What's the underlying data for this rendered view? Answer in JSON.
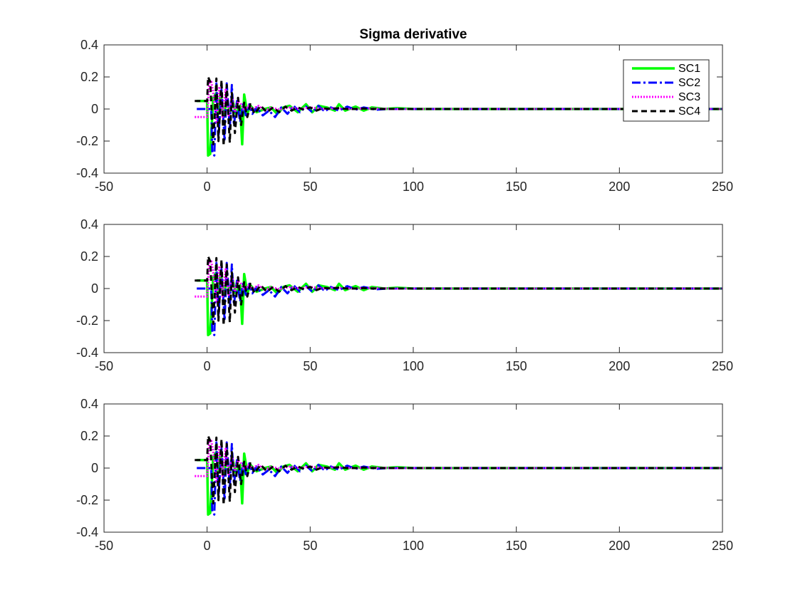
{
  "chart_data": [
    {
      "type": "line",
      "title": "Sigma derivative",
      "xlim": [
        -50,
        250
      ],
      "ylim": [
        -0.4,
        0.4
      ],
      "xticks": [
        -50,
        0,
        50,
        100,
        150,
        200,
        250
      ],
      "xtick_labels": [
        "-50",
        "0",
        "50",
        "100",
        "150",
        "200",
        "250"
      ],
      "yticks": [
        -0.4,
        -0.2,
        0,
        0.2,
        0.4
      ],
      "ytick_labels": [
        "-0.4",
        "-0.2",
        "0",
        "0.2",
        "0.4"
      ],
      "grid": false,
      "legend": {
        "placement": "top-right",
        "entries": [
          "SC1",
          "SC2",
          "SC3",
          "SC4"
        ]
      },
      "series": [
        {
          "name": "SC1",
          "color": "#00ff00",
          "style": "solid",
          "x": [
            -5,
            0,
            0.5,
            1.5,
            3,
            4.5,
            5.5,
            6.5,
            8,
            9.5,
            11,
            12.5,
            14,
            16,
            17,
            18,
            19.5,
            21,
            24,
            28,
            31,
            34,
            37,
            40,
            44,
            48,
            51,
            54,
            58,
            62,
            64,
            67,
            72,
            76,
            80,
            86,
            92,
            100,
            110,
            250
          ],
          "y": [
            0.05,
            0.05,
            -0.29,
            -0.28,
            0.07,
            0.1,
            -0.03,
            0.1,
            -0.05,
            0.06,
            -0.02,
            0.05,
            -0.03,
            0.02,
            -0.22,
            0.09,
            -0.03,
            0.02,
            -0.02,
            0.0,
            0.01,
            -0.03,
            0.01,
            0.02,
            -0.02,
            0.03,
            -0.02,
            0.02,
            0.01,
            -0.01,
            0.03,
            -0.01,
            0.015,
            -0.01,
            0.01,
            0.0,
            0.005,
            0.0,
            0.0,
            0.0
          ]
        },
        {
          "name": "SC2",
          "color": "#0000ff",
          "style": "dashdot",
          "x": [
            -5,
            2,
            2.5,
            3.5,
            4.5,
            5.5,
            7,
            8.5,
            9.5,
            11,
            12,
            13,
            14.5,
            16,
            17.5,
            19,
            20.5,
            22,
            24,
            27,
            30,
            33,
            36,
            39,
            42,
            45,
            48,
            51,
            54,
            57,
            60,
            64,
            68,
            72,
            76,
            82,
            88,
            96,
            106,
            250
          ],
          "y": [
            0.0,
            0.0,
            -0.27,
            -0.29,
            0.16,
            -0.18,
            0.12,
            -0.2,
            0.16,
            -0.12,
            0.15,
            -0.1,
            0.05,
            -0.08,
            0.03,
            -0.05,
            0.03,
            -0.03,
            0.01,
            -0.04,
            -0.01,
            -0.05,
            0.01,
            -0.03,
            0.02,
            -0.02,
            0.015,
            -0.02,
            0.02,
            -0.015,
            0.01,
            -0.01,
            0.015,
            -0.005,
            0.01,
            -0.005,
            0.0,
            0.0,
            0.0,
            0.0
          ]
        },
        {
          "name": "SC3",
          "color": "#ff00ff",
          "style": "dotted",
          "x": [
            -6,
            0,
            1,
            2,
            3,
            4.5,
            6,
            7.5,
            9,
            10.5,
            12,
            13.5,
            15,
            16.5,
            18,
            20,
            22,
            25,
            28,
            31,
            35,
            40,
            45,
            50,
            56,
            62,
            70,
            80,
            90,
            100,
            250
          ],
          "y": [
            -0.05,
            -0.05,
            0.16,
            0.17,
            0.1,
            -0.08,
            0.14,
            -0.05,
            0.12,
            -0.04,
            0.08,
            -0.02,
            0.05,
            0.03,
            -0.01,
            0.02,
            0.0,
            0.02,
            -0.01,
            0.01,
            -0.005,
            0.01,
            0.0,
            0.01,
            0.0,
            0.005,
            0.0,
            0.003,
            0.0,
            0.0,
            0.0
          ]
        },
        {
          "name": "SC4",
          "color": "#000000",
          "style": "dashed",
          "x": [
            -6,
            0,
            0.5,
            1.5,
            3,
            4.5,
            5.5,
            7,
            8,
            9.5,
            11,
            12,
            13.5,
            15,
            16.5,
            18,
            19.5,
            21,
            23,
            26,
            29,
            32,
            35,
            38,
            41,
            44,
            47,
            50,
            53,
            56,
            60,
            64,
            68,
            72,
            76,
            80,
            86,
            94,
            250
          ],
          "y": [
            0.05,
            0.05,
            0.2,
            0.17,
            -0.22,
            0.19,
            -0.2,
            0.18,
            -0.23,
            0.15,
            -0.21,
            0.1,
            -0.15,
            0.07,
            -0.1,
            0.04,
            -0.05,
            0.03,
            -0.03,
            0.02,
            -0.02,
            0.01,
            -0.02,
            0.015,
            -0.01,
            0.01,
            -0.005,
            0.01,
            -0.01,
            0.005,
            0.0,
            0.005,
            0.0,
            0.0,
            0.003,
            0.0,
            0.0,
            0.0,
            0.0
          ]
        }
      ]
    },
    {
      "type": "line",
      "title": "",
      "xlim": [
        -50,
        250
      ],
      "ylim": [
        -0.4,
        0.4
      ],
      "xticks": [
        -50,
        0,
        50,
        100,
        150,
        200,
        250
      ],
      "xtick_labels": [
        "-50",
        "0",
        "50",
        "100",
        "150",
        "200",
        "250"
      ],
      "yticks": [
        -0.4,
        -0.2,
        0,
        0.2,
        0.4
      ],
      "ytick_labels": [
        "-0.4",
        "-0.2",
        "0",
        "0.2",
        "0.4"
      ],
      "grid": false,
      "series": [
        {
          "color": "#00ff00",
          "style": "solid",
          "x": [
            -5,
            0,
            0.5,
            1.5,
            3,
            4.5,
            5.5,
            6.5,
            8,
            9.5,
            11,
            12.5,
            14,
            16,
            17,
            18,
            19.5,
            21,
            24,
            28,
            31,
            34,
            37,
            40,
            44,
            48,
            51,
            54,
            58,
            62,
            64,
            67,
            72,
            76,
            80,
            86,
            92,
            100,
            110,
            250
          ],
          "y": [
            0.05,
            0.05,
            -0.29,
            -0.28,
            0.07,
            0.1,
            -0.03,
            0.1,
            -0.05,
            0.06,
            -0.02,
            0.05,
            -0.03,
            0.02,
            -0.22,
            0.09,
            -0.03,
            0.02,
            -0.02,
            0.0,
            0.01,
            -0.03,
            0.01,
            0.02,
            -0.02,
            0.03,
            -0.02,
            0.02,
            0.01,
            -0.01,
            0.03,
            -0.01,
            0.015,
            -0.01,
            0.01,
            0.0,
            0.005,
            0.0,
            0.0,
            0.0
          ]
        },
        {
          "color": "#0000ff",
          "style": "dashdot",
          "x": [
            -5,
            2,
            2.5,
            3.5,
            4.5,
            5.5,
            7,
            8.5,
            9.5,
            11,
            12,
            13,
            14.5,
            16,
            17.5,
            19,
            20.5,
            22,
            24,
            27,
            30,
            33,
            36,
            39,
            42,
            45,
            48,
            51,
            54,
            57,
            60,
            64,
            68,
            72,
            76,
            82,
            88,
            96,
            106,
            250
          ],
          "y": [
            0.0,
            0.0,
            -0.27,
            -0.29,
            0.16,
            -0.18,
            0.12,
            -0.2,
            0.16,
            -0.12,
            0.15,
            -0.1,
            0.05,
            -0.08,
            0.03,
            -0.05,
            0.03,
            -0.03,
            0.01,
            -0.04,
            -0.01,
            -0.05,
            0.01,
            -0.03,
            0.02,
            -0.02,
            0.015,
            -0.02,
            0.02,
            -0.015,
            0.01,
            -0.01,
            0.015,
            -0.005,
            0.01,
            -0.005,
            0.0,
            0.0,
            0.0,
            0.0
          ]
        },
        {
          "color": "#ff00ff",
          "style": "dotted",
          "x": [
            -6,
            0,
            1,
            2,
            3,
            4.5,
            6,
            7.5,
            9,
            10.5,
            12,
            13.5,
            15,
            16.5,
            18,
            20,
            22,
            25,
            28,
            31,
            35,
            40,
            45,
            50,
            56,
            62,
            70,
            80,
            90,
            100,
            250
          ],
          "y": [
            -0.05,
            -0.05,
            0.16,
            0.17,
            0.1,
            -0.08,
            0.14,
            -0.05,
            0.12,
            -0.04,
            0.08,
            -0.02,
            0.05,
            0.03,
            -0.01,
            0.02,
            0.0,
            0.02,
            -0.01,
            0.01,
            -0.005,
            0.01,
            0.0,
            0.01,
            0.0,
            0.005,
            0.0,
            0.003,
            0.0,
            0.0,
            0.0
          ]
        },
        {
          "color": "#000000",
          "style": "dashed",
          "x": [
            -6,
            0,
            0.5,
            1.5,
            3,
            4.5,
            5.5,
            7,
            8,
            9.5,
            11,
            12,
            13.5,
            15,
            16.5,
            18,
            19.5,
            21,
            23,
            26,
            29,
            32,
            35,
            38,
            41,
            44,
            47,
            50,
            53,
            56,
            60,
            64,
            68,
            72,
            76,
            80,
            86,
            94,
            250
          ],
          "y": [
            0.05,
            0.05,
            0.2,
            0.17,
            -0.22,
            0.19,
            -0.2,
            0.18,
            -0.23,
            0.15,
            -0.21,
            0.1,
            -0.15,
            0.07,
            -0.1,
            0.04,
            -0.05,
            0.03,
            -0.03,
            0.02,
            -0.02,
            0.01,
            -0.02,
            0.015,
            -0.01,
            0.01,
            -0.005,
            0.01,
            -0.01,
            0.005,
            0.0,
            0.005,
            0.0,
            0.0,
            0.003,
            0.0,
            0.0,
            0.0,
            0.0
          ]
        }
      ]
    },
    {
      "type": "line",
      "title": "",
      "xlim": [
        -50,
        250
      ],
      "ylim": [
        -0.4,
        0.4
      ],
      "xticks": [
        -50,
        0,
        50,
        100,
        150,
        200,
        250
      ],
      "xtick_labels": [
        "-50",
        "0",
        "50",
        "100",
        "150",
        "200",
        "250"
      ],
      "yticks": [
        -0.4,
        -0.2,
        0,
        0.2,
        0.4
      ],
      "ytick_labels": [
        "-0.4",
        "-0.2",
        "0",
        "0.2",
        "0.4"
      ],
      "grid": false,
      "series": [
        {
          "color": "#00ff00",
          "style": "solid",
          "x": [
            -5,
            0,
            0.5,
            1.5,
            3,
            4.5,
            5.5,
            6.5,
            8,
            9.5,
            11,
            12.5,
            14,
            16,
            17,
            18,
            19.5,
            21,
            24,
            28,
            31,
            34,
            37,
            40,
            44,
            48,
            51,
            54,
            58,
            62,
            64,
            67,
            72,
            76,
            80,
            86,
            92,
            100,
            110,
            250
          ],
          "y": [
            0.05,
            0.05,
            -0.29,
            -0.28,
            0.07,
            0.1,
            -0.03,
            0.1,
            -0.05,
            0.06,
            -0.02,
            0.05,
            -0.03,
            0.02,
            -0.22,
            0.09,
            -0.03,
            0.02,
            -0.02,
            0.0,
            0.01,
            -0.03,
            0.01,
            0.02,
            -0.02,
            0.03,
            -0.02,
            0.02,
            0.01,
            -0.01,
            0.03,
            -0.01,
            0.015,
            -0.01,
            0.01,
            0.0,
            0.005,
            0.0,
            0.0,
            0.0
          ]
        },
        {
          "color": "#0000ff",
          "style": "dashdot",
          "x": [
            -5,
            2,
            2.5,
            3.5,
            4.5,
            5.5,
            7,
            8.5,
            9.5,
            11,
            12,
            13,
            14.5,
            16,
            17.5,
            19,
            20.5,
            22,
            24,
            27,
            30,
            33,
            36,
            39,
            42,
            45,
            48,
            51,
            54,
            57,
            60,
            64,
            68,
            72,
            76,
            82,
            88,
            96,
            106,
            250
          ],
          "y": [
            0.0,
            0.0,
            -0.27,
            -0.29,
            0.16,
            -0.18,
            0.12,
            -0.2,
            0.16,
            -0.12,
            0.15,
            -0.1,
            0.05,
            -0.08,
            0.03,
            -0.05,
            0.03,
            -0.03,
            0.01,
            -0.04,
            -0.01,
            -0.05,
            0.01,
            -0.03,
            0.02,
            -0.02,
            0.015,
            -0.02,
            0.02,
            -0.015,
            0.01,
            -0.01,
            0.015,
            -0.005,
            0.01,
            -0.005,
            0.0,
            0.0,
            0.0,
            0.0
          ]
        },
        {
          "color": "#ff00ff",
          "style": "dotted",
          "x": [
            -6,
            0,
            1,
            2,
            3,
            4.5,
            6,
            7.5,
            9,
            10.5,
            12,
            13.5,
            15,
            16.5,
            18,
            20,
            22,
            25,
            28,
            31,
            35,
            40,
            45,
            50,
            56,
            62,
            70,
            80,
            90,
            100,
            250
          ],
          "y": [
            -0.05,
            -0.05,
            0.16,
            0.17,
            0.1,
            -0.08,
            0.14,
            -0.05,
            0.12,
            -0.04,
            0.08,
            -0.02,
            0.05,
            0.03,
            -0.01,
            0.02,
            0.0,
            0.02,
            -0.01,
            0.01,
            -0.005,
            0.01,
            0.0,
            0.01,
            0.0,
            0.005,
            0.0,
            0.003,
            0.0,
            0.0,
            0.0
          ]
        },
        {
          "color": "#000000",
          "style": "dashed",
          "x": [
            -6,
            0,
            0.5,
            1.5,
            3,
            4.5,
            5.5,
            7,
            8,
            9.5,
            11,
            12,
            13.5,
            15,
            16.5,
            18,
            19.5,
            21,
            23,
            26,
            29,
            32,
            35,
            38,
            41,
            44,
            47,
            50,
            53,
            56,
            60,
            64,
            68,
            72,
            76,
            80,
            86,
            94,
            250
          ],
          "y": [
            0.05,
            0.05,
            0.2,
            0.17,
            -0.22,
            0.19,
            -0.2,
            0.18,
            -0.23,
            0.15,
            -0.21,
            0.1,
            -0.15,
            0.07,
            -0.1,
            0.04,
            -0.05,
            0.03,
            -0.03,
            0.02,
            -0.02,
            0.01,
            -0.02,
            0.015,
            -0.01,
            0.01,
            -0.005,
            0.01,
            -0.01,
            0.005,
            0.0,
            0.005,
            0.0,
            0.0,
            0.003,
            0.0,
            0.0,
            0.0,
            0.0
          ]
        }
      ]
    }
  ]
}
